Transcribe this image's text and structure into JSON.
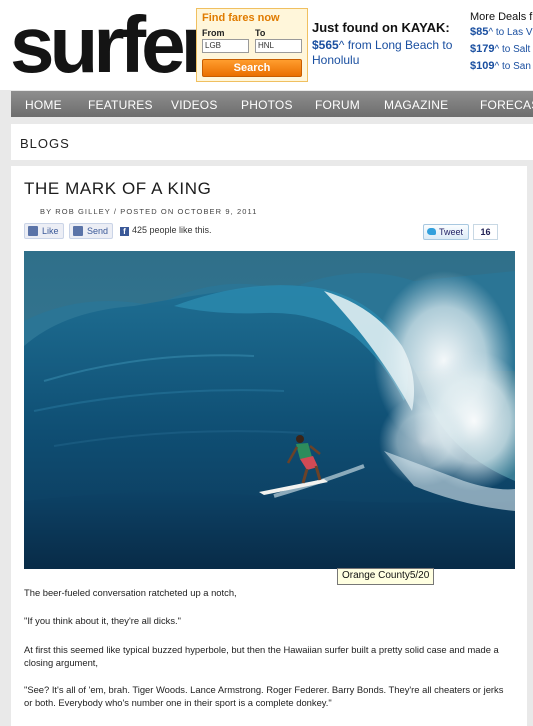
{
  "site": {
    "logo": "surfer"
  },
  "ad": {
    "find_fares": "Find fares now",
    "from_label": "From",
    "to_label": "To",
    "from_value": "LGB",
    "to_value": "HNL",
    "search_label": "Search",
    "headline": "Just found on KAYAK:",
    "price": "$565",
    "price_suffix": "^",
    "route": "from Long Beach to Honolulu",
    "more_deals_title": "More Deals f",
    "more_deals": [
      {
        "price": "$85",
        "suffix": "^",
        "dest": "to Las V"
      },
      {
        "price": "$179",
        "suffix": "^",
        "dest": "to Salt"
      },
      {
        "price": "$109",
        "suffix": "^",
        "dest": "to San"
      }
    ],
    "orange": "#ea7a00"
  },
  "nav": {
    "items": [
      "HOME",
      "FEATURES",
      "VIDEOS",
      "PHOTOS",
      "FORUM",
      "MAGAZINE",
      "FORECAS"
    ]
  },
  "section": {
    "title": "BLOGS"
  },
  "article": {
    "title": "THE MARK OF A KING",
    "byline": "BY ROB GILLEY  /  POSTED ON OCTOBER 9, 2011",
    "like_label": "Like",
    "send_label": "Send",
    "like_count_text": "425 people like this.",
    "tweet_label": "Tweet",
    "tweet_count": "16",
    "photo_tooltip": "Orange County5/20",
    "paragraphs": [
      "The beer-fueled conversation ratcheted up a notch,",
      "\"If you think about it, they're all dicks.\"",
      "At first this seemed like typical buzzed hyperbole, but then the Hawaiian surfer built a pretty solid case and made a closing argument,",
      "\"See? It's all of 'em, brah. Tiger Woods. Lance Armstrong. Roger Federer. Barry Bonds. They're all cheaters or jerks or both. Everybody who's number one in their sport is a complete donkey.\""
    ]
  },
  "colors": {
    "nav_bg": "#7b7b7b",
    "page_bg": "#e9e9e9",
    "link_blue": "#1a4fa0",
    "facebook_blue": "#3b5998"
  }
}
